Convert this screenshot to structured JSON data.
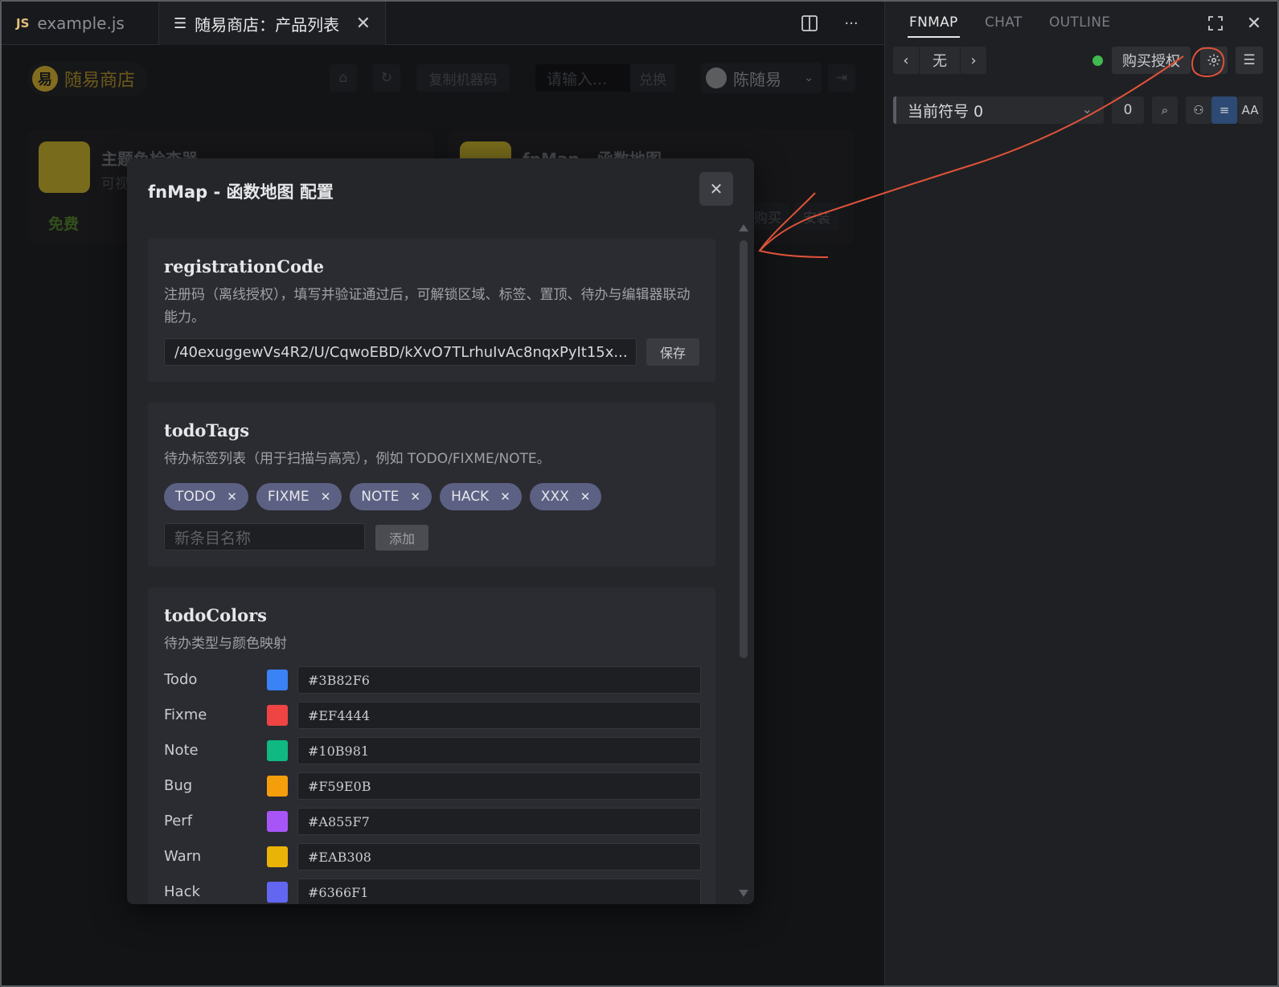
{
  "tabs": [
    {
      "badge": "JS",
      "label": "example.js"
    },
    {
      "label": "随易商店：产品列表"
    }
  ],
  "shop": {
    "brand_name": "随易商店",
    "copy_machine_code": "复制机器码",
    "code_input_placeholder": "请输入...",
    "redeem": "兑换",
    "user_name": "陈随易",
    "cards": [
      {
        "title": "主题色检查器",
        "subtitle": "可视",
        "price": "免费"
      },
      {
        "title": "fnMap - 函数地图",
        "buy": "购买",
        "install": "安装"
      }
    ]
  },
  "right_panel": {
    "tabs": [
      "FNMAP",
      "CHAT",
      "OUTLINE"
    ],
    "nav_value": "无",
    "buy_license": "购买授权",
    "symbol_select": "当前符号 0",
    "count": "0",
    "font_toggle": "AA"
  },
  "modal": {
    "title": "fnMap - 函数地图 配置",
    "registration": {
      "title": "registrationCode",
      "desc": "注册码（离线授权），填写并验证通过后，可解锁区域、标签、置顶、待办与编辑器联动能力。",
      "value": "/40exuggewVs4R2/U/CqwoEBD/kXvO7TLrhuIvAc8nqxPyIt15x...",
      "save": "保存"
    },
    "todo_tags": {
      "title": "todoTags",
      "desc": "待办标签列表（用于扫描与高亮），例如 TODO/FIXME/NOTE。",
      "tags": [
        "TODO",
        "FIXME",
        "NOTE",
        "HACK",
        "XXX"
      ],
      "new_placeholder": "新条目名称",
      "add": "添加"
    },
    "todo_colors": {
      "title": "todoColors",
      "desc": "待办类型与颜色映射",
      "rows": [
        {
          "label": "Todo",
          "hex": "#3B82F6"
        },
        {
          "label": "Fixme",
          "hex": "#EF4444"
        },
        {
          "label": "Note",
          "hex": "#10B981"
        },
        {
          "label": "Bug",
          "hex": "#F59E0B"
        },
        {
          "label": "Perf",
          "hex": "#A855F7"
        },
        {
          "label": "Warn",
          "hex": "#EAB308"
        },
        {
          "label": "Hack",
          "hex": "#6366F1"
        }
      ]
    }
  },
  "colors": {
    "annotation": "#e0533a",
    "status_online": "#3fb950",
    "tag_bg": "#5c6184",
    "brand": "#c8a632"
  }
}
